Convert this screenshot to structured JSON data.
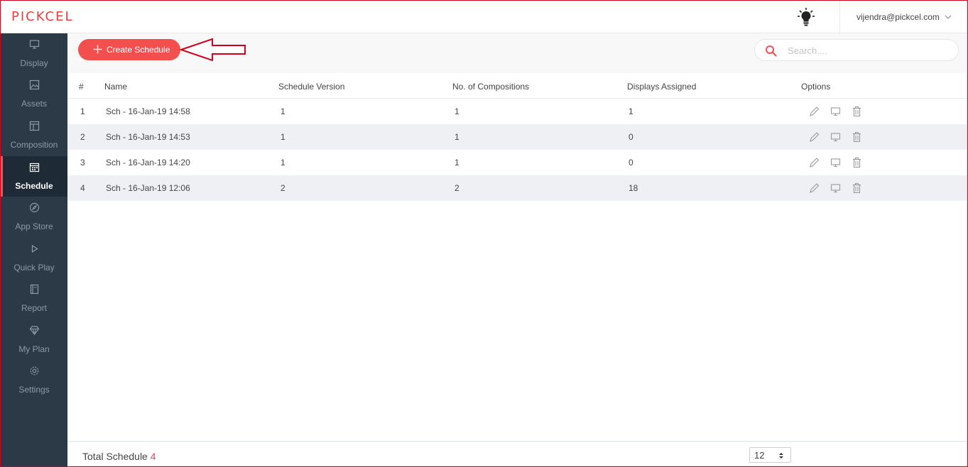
{
  "header": {
    "logo": "PICKCEL",
    "user_email": "vijendra@pickcel.com"
  },
  "sidebar": {
    "items": [
      {
        "label": "Display",
        "icon": "monitor-icon"
      },
      {
        "label": "Assets",
        "icon": "image-icon"
      },
      {
        "label": "Composition",
        "icon": "layout-icon"
      },
      {
        "label": "Schedule",
        "icon": "calendar-icon",
        "active": true
      },
      {
        "label": "App Store",
        "icon": "compass-icon"
      },
      {
        "label": "Quick Play",
        "icon": "play-icon"
      },
      {
        "label": "Report",
        "icon": "report-icon"
      },
      {
        "label": "My Plan",
        "icon": "diamond-icon"
      },
      {
        "label": "Settings",
        "icon": "gear-icon"
      }
    ]
  },
  "toolbar": {
    "create_label": "Create Schedule",
    "search_placeholder": "Search...."
  },
  "table": {
    "columns": [
      "#",
      "Name",
      "Schedule Version",
      "No. of Compositions",
      "Displays Assigned",
      "Options"
    ],
    "rows": [
      {
        "num": "1",
        "name": "Sch - 16-Jan-19 14:58",
        "version": "1",
        "compositions": "1",
        "displays": "1"
      },
      {
        "num": "2",
        "name": "Sch - 16-Jan-19 14:53",
        "version": "1",
        "compositions": "1",
        "displays": "0"
      },
      {
        "num": "3",
        "name": "Sch - 16-Jan-19 14:20",
        "version": "1",
        "compositions": "1",
        "displays": "0"
      },
      {
        "num": "4",
        "name": "Sch - 16-Jan-19 12:06",
        "version": "2",
        "compositions": "2",
        "displays": "18"
      }
    ]
  },
  "footer": {
    "total_label": "Total Schedule",
    "total_count": "4",
    "page_size": "12"
  },
  "colors": {
    "accent": "#f44f4f",
    "sidebar_bg": "#2c3a47",
    "sidebar_active_bg": "#1e2a35"
  }
}
